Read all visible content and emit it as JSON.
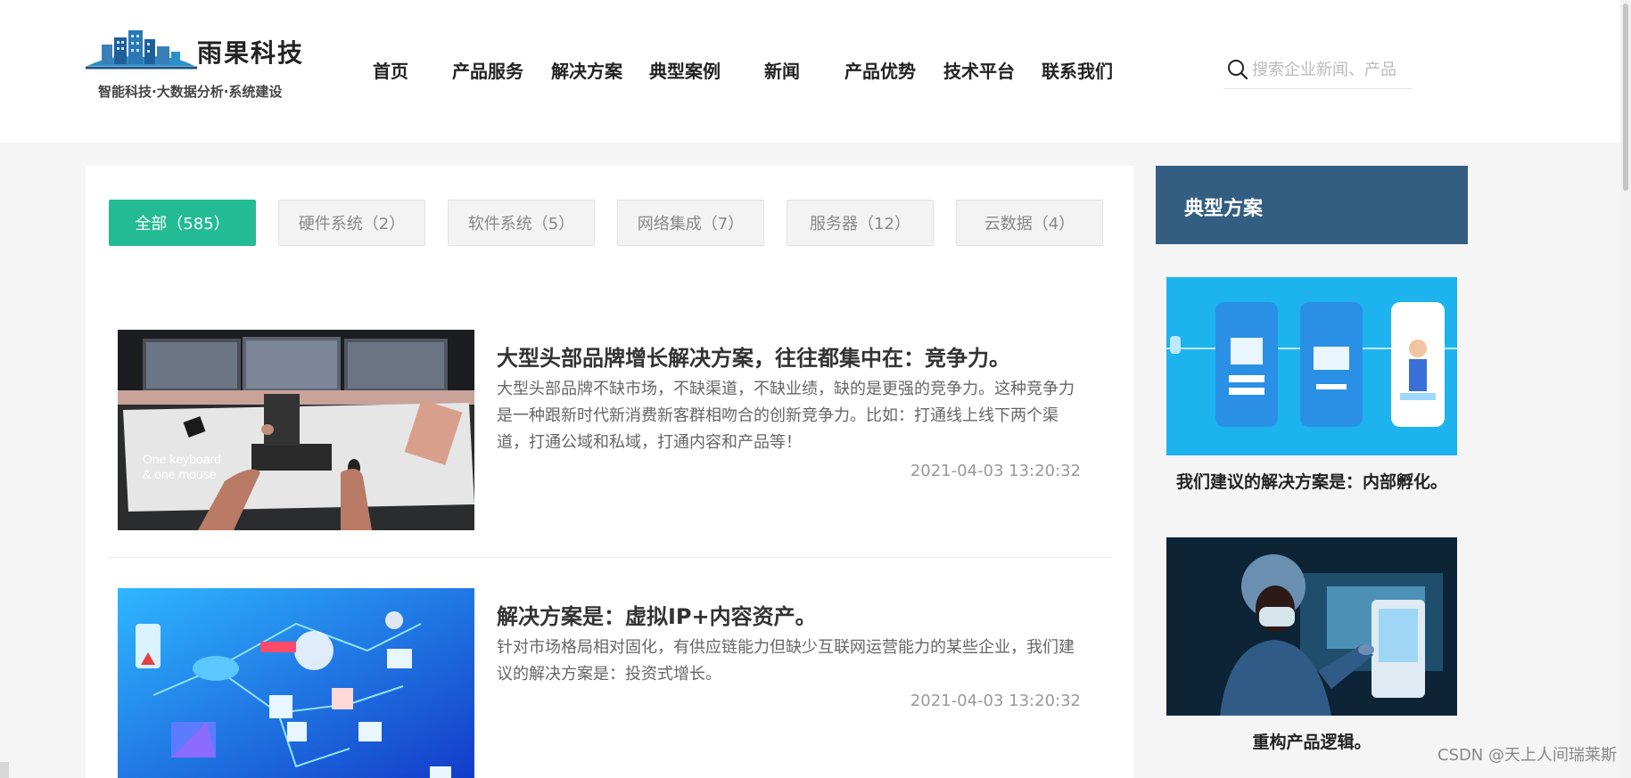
{
  "brand": {
    "name": "雨果科技",
    "slogan": "智能科技·大数据分析·系统建设"
  },
  "nav": [
    "首页",
    "产品服务",
    "解决方案",
    "典型案例",
    "新闻",
    "产品优势",
    "技术平台",
    "联系我们"
  ],
  "search": {
    "placeholder": "搜索企业新闻、产品",
    "icon": "search-icon"
  },
  "filters": [
    {
      "label": "全部（585）",
      "active": true
    },
    {
      "label": "硬件系统（2）",
      "active": false
    },
    {
      "label": "软件系统（5）",
      "active": false
    },
    {
      "label": "网络集成（7）",
      "active": false
    },
    {
      "label": "服务器（12）",
      "active": false
    },
    {
      "label": "云数据（4）",
      "active": false
    }
  ],
  "articles": [
    {
      "title": "大型头部品牌增长解决方案，往往都集中在：竞争力。",
      "description": "大型头部品牌不缺市场，不缺渠道，不缺业绩，缺的是更强的竞争力。这种竞争力是一种跟新时代新消费新客群相吻合的创新竞争力。比如：打通线上线下两个渠道，打通公域和私域，打通内容和产品等！",
      "date": "2021-04-03 13:20:32",
      "image_text": "One keyboard\n& one mouse"
    },
    {
      "title": "解决方案是：虚拟IP+内容资产。",
      "description": "针对市场格局相对固化，有供应链能力但缺少互联网运营能力的某些企业，我们建议的解决方案是：投资式增长。",
      "date": "2021-04-03 13:20:32"
    }
  ],
  "sidebar": {
    "title": "典型方案",
    "items": [
      {
        "caption": "我们建议的解决方案是：内部孵化。"
      },
      {
        "caption": "重构产品逻辑。"
      }
    ]
  },
  "watermark": "CSDN @天上人间瑞莱斯",
  "colors": {
    "accent": "#23bb93",
    "sidebar_header": "#335e82"
  }
}
